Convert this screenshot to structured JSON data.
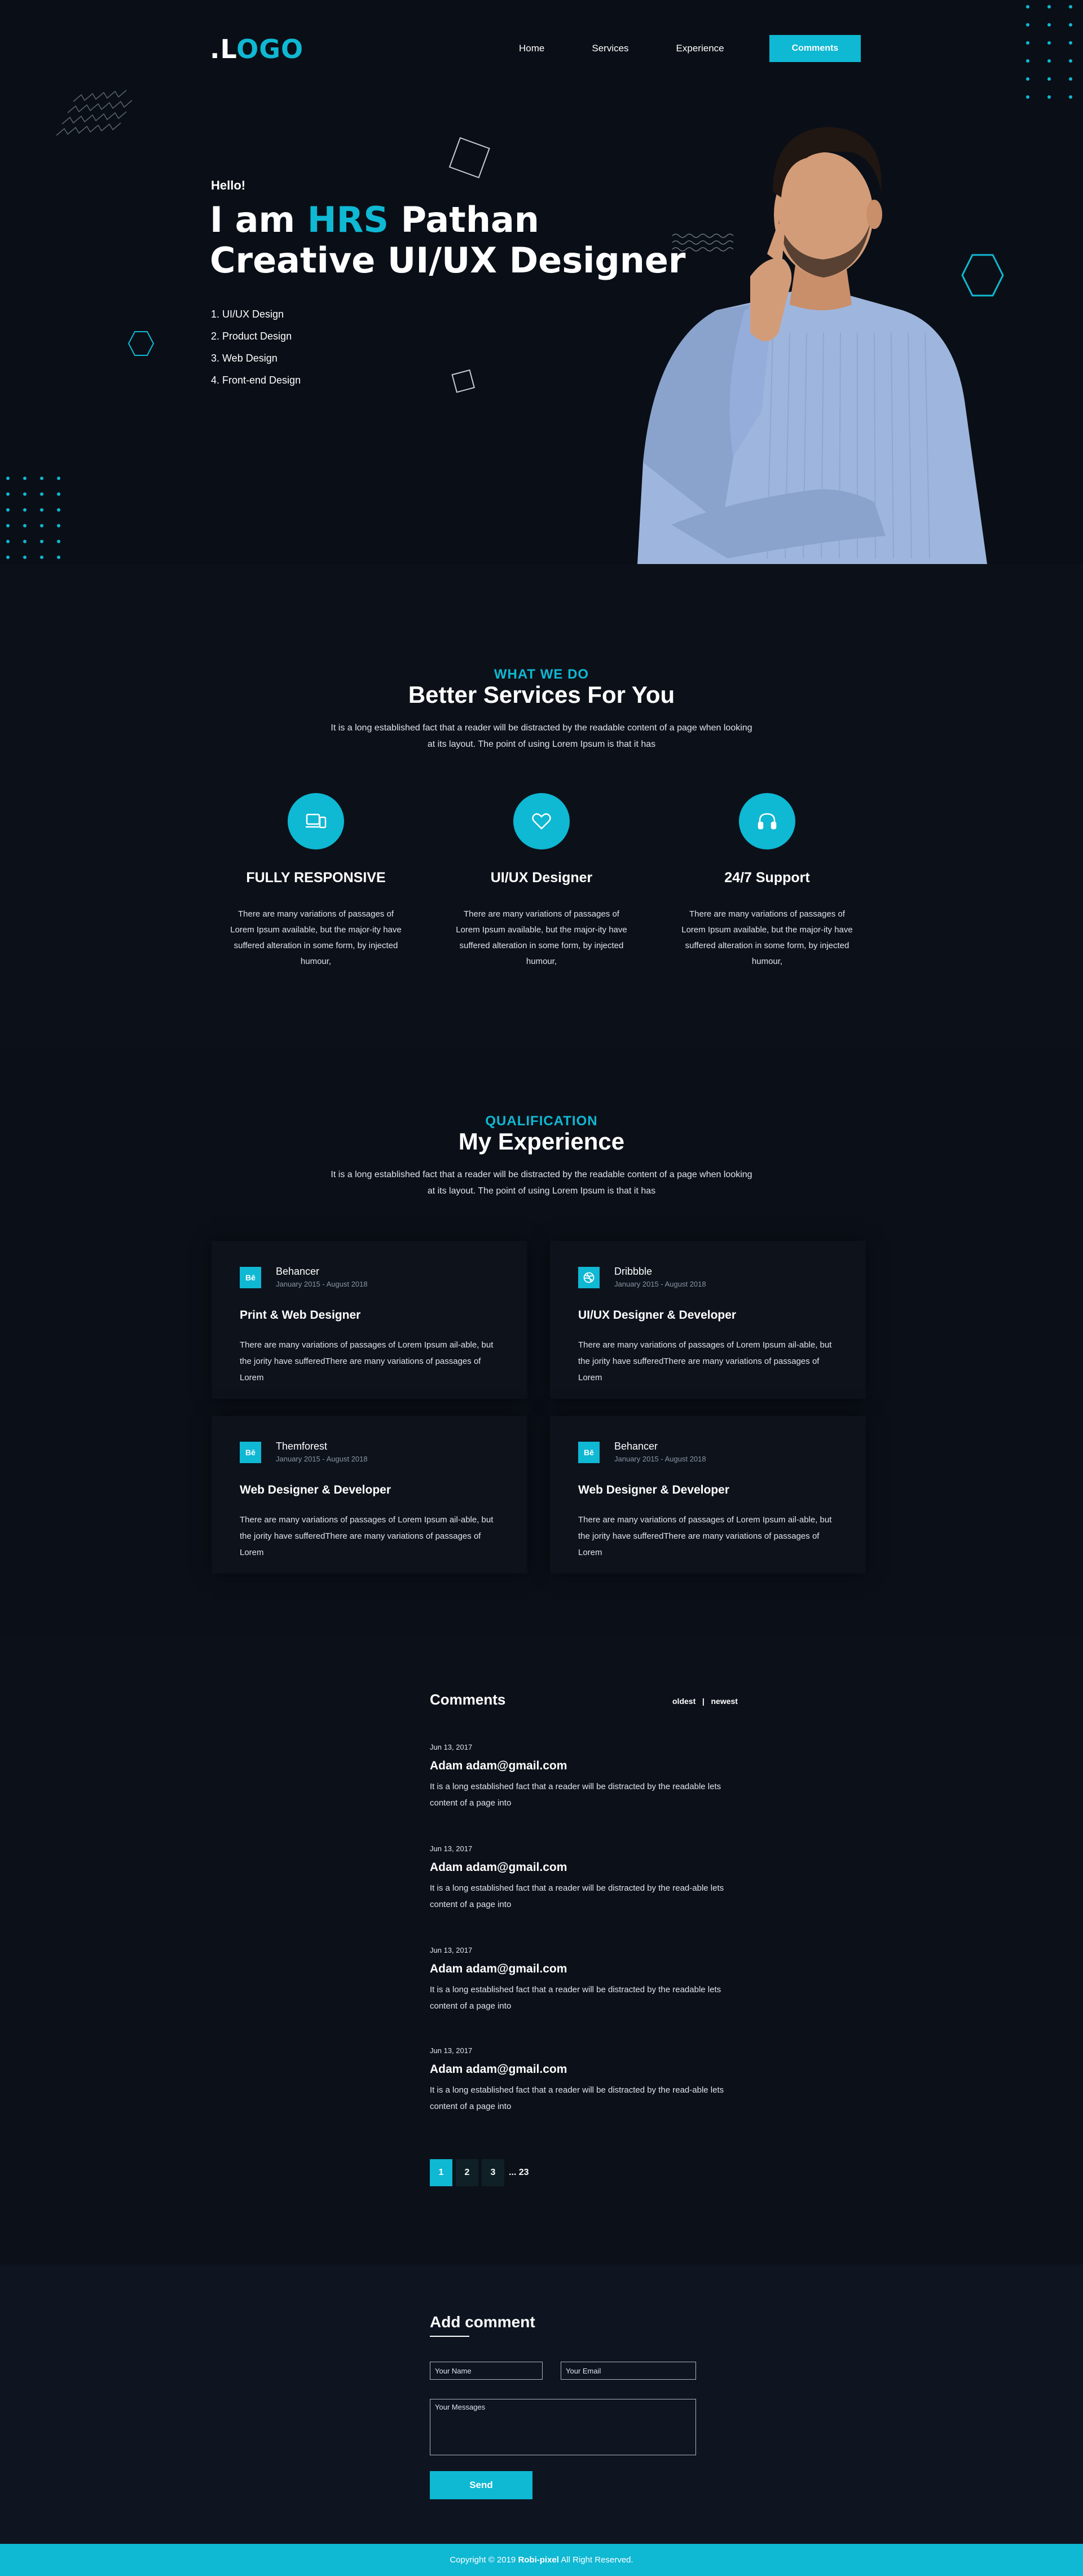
{
  "brand": {
    "dot": ".",
    "logo_part1": "L",
    "logo_part2": "OGO"
  },
  "nav": {
    "items": [
      {
        "label": "Home"
      },
      {
        "label": "Services"
      },
      {
        "label": "Experience"
      }
    ],
    "cta": "Comments"
  },
  "hero": {
    "greeting": "Hello!",
    "line1_prefix": "I am ",
    "line1_highlight": "HRS",
    "line1_suffix": " Pathan",
    "line2": "Creative UI/UX Designer",
    "skills": [
      "1. UI/UX Design",
      "2. Product Design",
      "3. Web Design",
      "4. Front-end Design"
    ]
  },
  "services": {
    "eyebrow": "WHAT WE DO",
    "title": "Better Services For You",
    "description": "It is a long established fact that a reader will be distracted by the readable content of a page when looking at its layout. The point of using Lorem Ipsum is that it has",
    "items": [
      {
        "icon": "devices-icon",
        "title": "FULLY RESPONSIVE",
        "text": "There are many variations of passages of Lorem Ipsum available, but the major-ity have suffered alteration in some form, by injected humour,"
      },
      {
        "icon": "heart-icon",
        "title": "UI/UX Designer",
        "text": "There are many variations of passages of Lorem Ipsum available, but the major-ity have suffered alteration in some form, by injected humour,"
      },
      {
        "icon": "headset-icon",
        "title": "24/7 Support",
        "text": "There are many variations of passages of Lorem Ipsum available, but the major-ity have suffered alteration in some form, by injected humour,"
      }
    ]
  },
  "experience": {
    "eyebrow": "QUALIFICATION",
    "title": "My Experience",
    "description": "It is a long established fact that a reader will be distracted by the readable content of a page when looking at its layout. The point of using Lorem Ipsum is that it has",
    "cards": [
      {
        "badge": "Bē",
        "icon": "behance-icon",
        "company": "Behancer",
        "dates": "January 2015 - August 2018",
        "role": "Print & Web Designer",
        "text": "There are many variations of passages of Lorem Ipsum ail-able, but the jority have sufferedThere are many variations of passages of Lorem"
      },
      {
        "badge": "",
        "icon": "dribbble-icon",
        "company": "Dribbble",
        "dates": "January 2015 - August 2018",
        "role": "UI/UX Designer & Developer",
        "text": "There are many variations of passages of Lorem Ipsum ail-able, but the jority have sufferedThere are many variations of passages of Lorem"
      },
      {
        "badge": "Bē",
        "icon": "behance-icon",
        "company": "Themforest",
        "dates": "January 2015 - August 2018",
        "role": "Web Designer & Developer",
        "text": "There are many variations of passages of Lorem Ipsum ail-able, but the jority have sufferedThere are many variations of passages of Lorem"
      },
      {
        "badge": "Bē",
        "icon": "behance-icon",
        "company": "Behancer",
        "dates": "January 2015 - August 2018",
        "role": "Web Designer & Developer",
        "text": "There are many variations of passages of Lorem Ipsum ail-able, but the jority have sufferedThere are many variations of passages of Lorem"
      }
    ]
  },
  "comments": {
    "title": "Comments",
    "sort_oldest": "oldest",
    "sort_sep": "|",
    "sort_newest": "newest",
    "items": [
      {
        "date": "Jun 13, 2017",
        "name": "Adam  adam@gmail.com",
        "text": "It is a long established fact that a reader will be distracted by the readable lets content of a page into"
      },
      {
        "date": "Jun 13, 2017",
        "name": "Adam  adam@gmail.com",
        "text": "It is a long established fact that a reader will be distracted by the read-able lets content of a page into"
      },
      {
        "date": "Jun 13, 2017",
        "name": "Adam  adam@gmail.com",
        "text": "It is a long established fact that a reader will be distracted by the readable lets content of a page into"
      },
      {
        "date": "Jun 13, 2017",
        "name": "Adam  adam@gmail.com",
        "text": "It is a long established fact that a reader will be distracted by the read-able lets content of a page into"
      }
    ],
    "pagination": {
      "pages": [
        "1",
        "2",
        "3"
      ],
      "more": "... 23",
      "current": "1"
    }
  },
  "add_comment": {
    "title": "Add comment",
    "name_placeholder": "Your Name",
    "email_placeholder": "Your Email",
    "message_placeholder": "Your Messages",
    "send_label": "Send"
  },
  "footer": {
    "prefix": "Copyright © 2019 ",
    "brand": "Robi-pixel",
    "suffix": " All Right Reserved."
  },
  "colors": {
    "accent": "#0fb8d3",
    "background": "#0c1119",
    "text": "#ffffff"
  }
}
